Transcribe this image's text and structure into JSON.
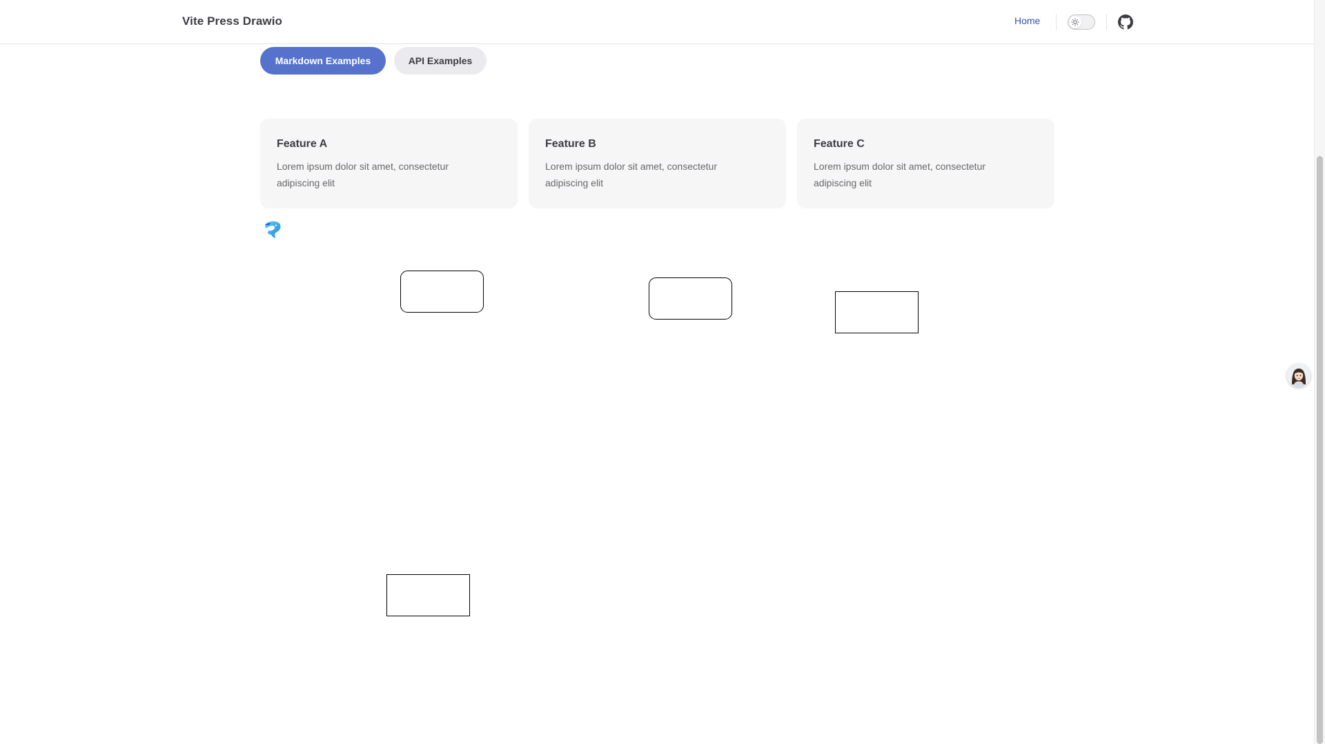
{
  "navbar": {
    "site_title": "Vite Press Drawio",
    "nav_links": [
      {
        "label": "Home",
        "active": true
      }
    ],
    "github_icon": "github-icon",
    "theme_toggle_icon": "sun-icon"
  },
  "hero": {
    "actions": [
      {
        "label": "Markdown Examples",
        "theme": "brand",
        "color": "#5672cd"
      },
      {
        "label": "API Examples",
        "theme": "alt",
        "color": "#ebebef"
      }
    ]
  },
  "features": [
    {
      "title": "Feature A",
      "details": "Lorem ipsum dolor sit amet, consectetur adipiscing elit"
    },
    {
      "title": "Feature B",
      "details": "Lorem ipsum dolor sit amet, consectetur adipiscing elit"
    },
    {
      "title": "Feature C",
      "details": "Lorem ipsum dolor sit amet, consectetur adipiscing elit"
    }
  ],
  "diagram": {
    "logo_icon": "drawio-dolphin-icon",
    "shapes": [
      {
        "kind": "rounded-rectangle",
        "label": ""
      },
      {
        "kind": "rounded-rectangle",
        "label": ""
      },
      {
        "kind": "rectangle",
        "label": ""
      },
      {
        "kind": "rectangle",
        "label": ""
      }
    ]
  },
  "floating_widget": {
    "icon": "assistant-avatar-icon"
  },
  "colors": {
    "brand": "#5672cd",
    "link": "#3451b2",
    "text": "#3c3c43",
    "muted_text": "#67676c",
    "card_bg": "#f6f6f7",
    "drawio_logo": "#1da1f2"
  }
}
